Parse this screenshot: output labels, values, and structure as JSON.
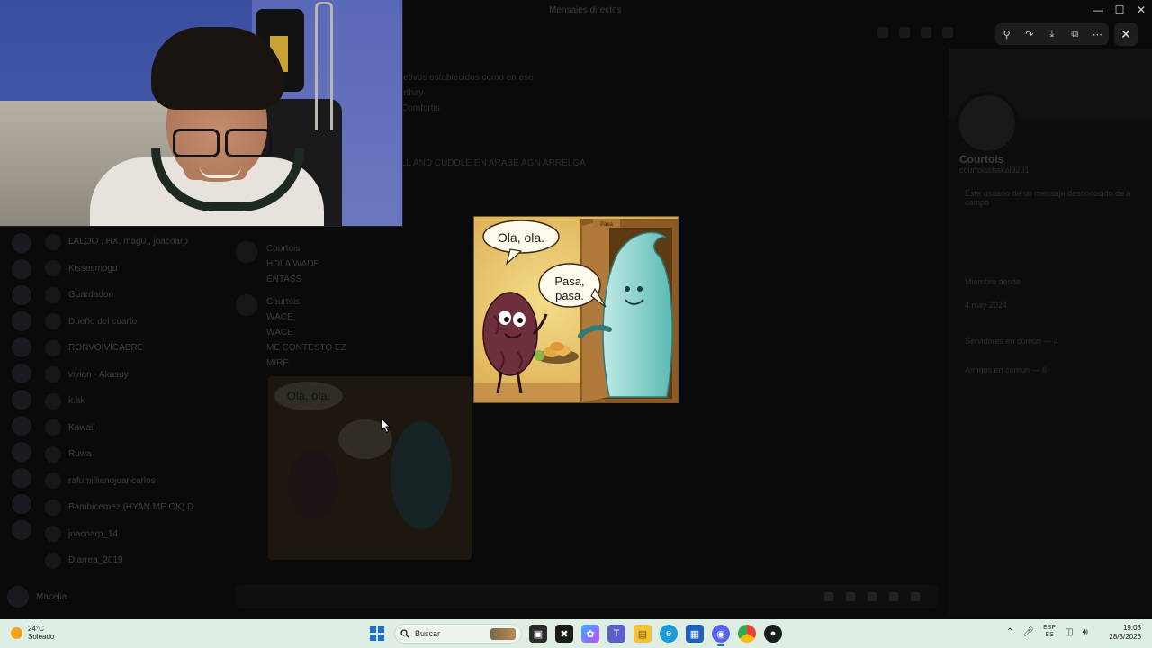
{
  "window": {
    "title": "Mensajes directos"
  },
  "viewer_toolbar": {
    "zoom_icon": "zoom-in-icon",
    "forward_icon": "forward-icon",
    "download_icon": "download-icon",
    "open_icon": "open-external-icon",
    "more_icon": "more-icon",
    "close_icon": "close-icon"
  },
  "chat_top_lines": [
    "jetivos establecidos como en ese",
    "irthay",
    "Comfortis",
    "LL AND CUDDLE EN ARABE AGN ARRELGA"
  ],
  "dm_list": [
    "LALOO , HX, mag0 , joacoarp",
    "Kissesmogu",
    "Guardadoo",
    "Dueño del cuarto",
    "RONVOIVICABRE",
    "vivian · Akasuy",
    "k.ak",
    "Kawaii",
    "Ruwa",
    "rafumillianojuancarlos",
    "Bambicemez (HYAN ME OK) D",
    "joacoarp_14",
    "Diarrea_2019"
  ],
  "user_bar": {
    "name": "Macelia"
  },
  "messages": [
    {
      "author": "Courtois",
      "lines": [
        "HOLA WADE",
        "ENTASS"
      ]
    },
    {
      "author": "Courtois",
      "lines": [
        "WACE",
        "WACE",
        "ME CONTESTO EZ",
        "MIRE"
      ]
    }
  ],
  "profile": {
    "name": "Courtois",
    "handle": "courtoisshakal9231",
    "lines": [
      "Este usuario de un mensaje desconocido de a campo",
      "Miembro desde",
      "4 may 2024",
      "Servidores en común — 4",
      "Amigos en común — 6"
    ]
  },
  "meme": {
    "bubble_left": "Ola, ola.",
    "bubble_right": "Pasa, pasa.",
    "door_sign": "Pasa"
  },
  "taskbar": {
    "weather_temp": "24°C",
    "weather_desc": "Soleado",
    "search_label": "Buscar",
    "lang_top": "ESP",
    "lang_bottom": "ES",
    "time": "19:03",
    "date": "28/3/2026"
  }
}
